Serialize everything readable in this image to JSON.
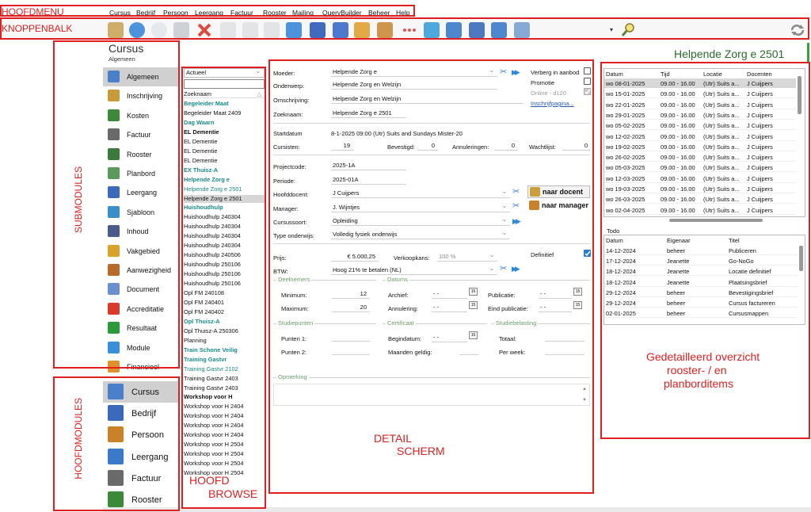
{
  "annotations": {
    "hoofdmenu": "HOOFDMENU",
    "knoppenbalk": "KNOPPENBALK",
    "submodules": "SUBMODULES",
    "hoofdmodules": "HOOFDMODULES",
    "hoofd_browse_1": "HOOFD",
    "hoofd_browse_2": "BROWSE",
    "detail_1": "DETAIL",
    "detail_2": "SCHERM",
    "overzicht_1": "Gedetailleerd overzicht",
    "overzicht_2": "rooster- / en",
    "overzicht_3": "planborditems"
  },
  "menu": [
    "Cursus",
    "Bedrijf",
    "Persoon",
    "Leergang",
    "Factuur",
    "Rooster",
    "Mailing",
    "QueryBuilder",
    "Beheer",
    "Help"
  ],
  "toolbar": {
    "icons": [
      "person-card-icon",
      "back-icon",
      "forward-icon",
      "edit-icon",
      "delete-icon",
      "save-icon",
      "undo-icon",
      "copy-icon",
      "mail-icon",
      "word-icon",
      "document-icon",
      "folder-icon",
      "users-icon",
      "dots-icon",
      "pen-icon",
      "print-icon",
      "chart-icon",
      "write-icon",
      "check-doc-icon"
    ],
    "search_icon": "search-icon",
    "refresh_icon": "refresh-icon"
  },
  "header": {
    "module_title": "Cursus",
    "module_sub": "Algemeen",
    "record_title": "Helpende Zorg e 2501"
  },
  "submodules": [
    "Algemeen",
    "Inschrijving",
    "Kosten",
    "Factuur",
    "Rooster",
    "Planbord",
    "Leergang",
    "Sjabloon",
    "Inhoud",
    "Vakgebied",
    "Aanwezigheid",
    "Document",
    "Accreditatie",
    "Resultaat",
    "Module",
    "Financieel"
  ],
  "submodule_colors": [
    "#4a7fc9",
    "#c79a3a",
    "#3a8a3a",
    "#6a6a6a",
    "#3a7a3a",
    "#5a9a5a",
    "#3a6ab9",
    "#3a8fc9",
    "#4a5a8a",
    "#d9a22a",
    "#b86a2a",
    "#6a8fcf",
    "#d93a2a",
    "#2a9a3a",
    "#3a8fd9",
    "#e0902a"
  ],
  "hoofdmodules": [
    "Cursus",
    "Bedrijf",
    "Persoon",
    "Leergang",
    "Factuur",
    "Rooster"
  ],
  "hoofdmodule_colors": [
    "#4a7fc9",
    "#3a6ab9",
    "#c9822a",
    "#3a7ac9",
    "#6a6a6a",
    "#3a8a3a"
  ],
  "browse": {
    "filter": "Actueel",
    "search_value": "",
    "column": "Zoeknaam",
    "rows": [
      {
        "t": "Begeleider Maat",
        "s": "bold"
      },
      {
        "t": "Begeleider Maat 2409",
        "s": ""
      },
      {
        "t": "Dag Waarn",
        "s": "bold"
      },
      {
        "t": "EL Dementie",
        "s": "black"
      },
      {
        "t": "EL Dementie",
        "s": ""
      },
      {
        "t": "EL Dementie",
        "s": ""
      },
      {
        "t": "EL Dementie",
        "s": ""
      },
      {
        "t": "EX Thuisz-A",
        "s": "bold"
      },
      {
        "t": "Helpende Zorg e",
        "s": "bold"
      },
      {
        "t": "Helpende Zorg e 2501",
        "s": "teal"
      },
      {
        "t": "Helpende Zorg e 2501",
        "s": "sel"
      },
      {
        "t": "Huishoudhulp",
        "s": "bold"
      },
      {
        "t": "Huishoudhulp 240304",
        "s": ""
      },
      {
        "t": "Huishoudhulp 240304",
        "s": ""
      },
      {
        "t": "Huishoudhulp 240304",
        "s": ""
      },
      {
        "t": "Huishoudhulp 240304",
        "s": ""
      },
      {
        "t": "Huishoudhulp 240506",
        "s": ""
      },
      {
        "t": "Huishoudhulp 250106",
        "s": ""
      },
      {
        "t": "Huishoudhulp 250106",
        "s": ""
      },
      {
        "t": "Huishoudhulp 250106",
        "s": ""
      },
      {
        "t": "Opl FM 240108",
        "s": ""
      },
      {
        "t": "Opl FM 240401",
        "s": ""
      },
      {
        "t": "Opl FM 240402",
        "s": ""
      },
      {
        "t": "Opl Thuisz-A",
        "s": "bold"
      },
      {
        "t": "Opl Thuisz-A 250306",
        "s": ""
      },
      {
        "t": "Planning",
        "s": ""
      },
      {
        "t": "Train Schone Veilig",
        "s": "bold"
      },
      {
        "t": "Training Gastvr",
        "s": "bold"
      },
      {
        "t": "Training Gastvr 2102",
        "s": "teal"
      },
      {
        "t": "Training Gastvr 2403",
        "s": ""
      },
      {
        "t": "Training Gastvr 2403",
        "s": ""
      },
      {
        "t": "Workshop voor H",
        "s": "black"
      },
      {
        "t": "Workshop voor H 2404",
        "s": ""
      },
      {
        "t": "Workshop voor H 2404",
        "s": ""
      },
      {
        "t": "Workshop voor H 2404",
        "s": ""
      },
      {
        "t": "Workshop voor H 2404",
        "s": ""
      },
      {
        "t": "Workshop voor H 2504",
        "s": ""
      },
      {
        "t": "Workshop voor H 2504",
        "s": ""
      },
      {
        "t": "Workshop voor H 2504",
        "s": ""
      },
      {
        "t": "Workshop voor H 2504",
        "s": ""
      }
    ]
  },
  "detail": {
    "moeder_label": "Moeder:",
    "moeder": "Helpende Zorg e",
    "onderwerp_label": "Onderwerp:",
    "onderwerp": "Helpende Zorg en Welzijn",
    "omschrijving_label": "Omschrijving:",
    "omschrijving": "Helpende Zorg en Welzijn",
    "zoeknaam_label": "Zoeknaam:",
    "zoeknaam": "Helpende Zorg e 2501",
    "verberg_label": "Verberg in aanbod",
    "promotie_label": "Promotie",
    "online_label": "Online - d120",
    "inschrijf_link": "Inschrijfpagina...",
    "startdatum_label": "Startdatum",
    "startdatum": "8-1-2025 09:00 (Utr) Suits and Sundays Mister-20",
    "cursisten_label": "Cursisten:",
    "cursisten": "19",
    "bevestigd_label": "Bevestigd:",
    "bevestigd": "0",
    "annuleringen_label": "Annuleringen:",
    "annuleringen": "0",
    "wachtlijst_label": "Wachtlijst:",
    "wachtlijst": "0",
    "projectcode_label": "Projectcode:",
    "projectcode": "2025-1A",
    "periode_label": "Periode:",
    "periode": "2025-01A",
    "hoofddocent_label": "Hoofddocent:",
    "hoofddocent": "J Cuijpers",
    "manager_label": "Manager:",
    "manager": "J. Wijntjes",
    "naar_docent": "naar docent",
    "naar_manager": "naar manager",
    "cursussoort_label": "Cursussoort:",
    "cursussoort": "Opleiding",
    "type_label": "Type onderwijs:",
    "type": "Volledig fysiek onderwijs",
    "prijs_label": "Prijs:",
    "prijs": "€ 5.000,25",
    "verkoopkans_label": "Verkoopkans:",
    "verkoopkans": "100 %",
    "definitief_label": "Definitief",
    "btw_label": "BTW:",
    "btw": "Hoog 21% te betalen (NL)",
    "deelnemers_grp": "Deelnemers",
    "minimum_label": "Minimum:",
    "minimum": "12",
    "maximum_label": "Maximum:",
    "maximum": "20",
    "datums_grp": "Datums",
    "archief_label": "Archief:",
    "archief": "- -",
    "annulering_label": "Annulering:",
    "annulering": "- -",
    "publicatie_label": "Publicatie:",
    "publicatie": "- -",
    "eind_publicatie_label": "Eind publicatie:",
    "eind_publicatie": "- -",
    "studiepunten_grp": "Studiepunten",
    "punten1_label": "Punten 1:",
    "punten1": "",
    "punten2_label": "Punten 2:",
    "punten2": "",
    "certificaat_grp": "Certificaat",
    "begindatum_label": "Begindatum:",
    "begindatum": "- -",
    "maanden_label": "Maanden geldig:",
    "maanden": "",
    "studiebelasting_grp": "Studiebelasting",
    "totaal_label": "Totaal:",
    "totaal": "",
    "perweek_label": "Per week:",
    "perweek": "",
    "opmerking_grp": "Opmerking",
    "opmerking": ""
  },
  "rooster": {
    "headers": [
      "Datum",
      "Tijd",
      "Locatie",
      "Docenten"
    ],
    "rows": [
      [
        "wo 08-01-2025",
        "09.00 - 16.00",
        "(Utr) Suits a...",
        "J Cuijpers"
      ],
      [
        "wo 15-01-2025",
        "09.00 - 16.00",
        "(Utr) Suits a...",
        "J Cuijpers"
      ],
      [
        "wo 22-01-2025",
        "09.00 - 16.00",
        "(Utr) Suits a...",
        "J Cuijpers"
      ],
      [
        "wo 29-01-2025",
        "09.00 - 16.00",
        "(Utr) Suits a...",
        "J Cuijpers"
      ],
      [
        "wo 05-02-2025",
        "09.00 - 16.00",
        "(Utr) Suits a...",
        "J Cuijpers"
      ],
      [
        "wo 12-02-2025",
        "09.00 - 16.00",
        "(Utr) Suits a...",
        "J Cuijpers"
      ],
      [
        "wo 19-02-2025",
        "09.00 - 16.00",
        "(Utr) Suits a...",
        "J Cuijpers"
      ],
      [
        "wo 26-02-2025",
        "09.00 - 16.00",
        "(Utr) Suits a...",
        "J Cuijpers"
      ],
      [
        "wo 05-03-2025",
        "09.00 - 16.00",
        "(Utr) Suits a...",
        "J Cuijpers"
      ],
      [
        "wo 12-03-2025",
        "09.00 - 16.00",
        "(Utr) Suits a...",
        "J Cuijpers"
      ],
      [
        "wo 19-03-2025",
        "09.00 - 16.00",
        "(Utr) Suits a...",
        "J Cuijpers"
      ],
      [
        "wo 26-03-2025",
        "09.00 - 16.00",
        "(Utr) Suits a...",
        "J Cuijpers"
      ],
      [
        "wo 02-04-2025",
        "09.00 - 16.00",
        "(Utr) Suits a...",
        "J Cuijpers"
      ]
    ]
  },
  "todo": {
    "title": "Todo",
    "headers": [
      "Datum",
      "Eigenaar",
      "Titel"
    ],
    "rows": [
      [
        "14-12-2024",
        "beheer",
        "Publiceren"
      ],
      [
        "17-12-2024",
        "Jeanette",
        "Go-NoGo"
      ],
      [
        "18-12-2024",
        "Jeanette",
        "Locatie definitief"
      ],
      [
        "18-12-2024",
        "Jeanette",
        "Plaatsingsbrief"
      ],
      [
        "29-12-2024",
        "beheer",
        "Bevestigingsbrief"
      ],
      [
        "29-12-2024",
        "beheer",
        "Cursus factureren"
      ],
      [
        "02-01-2025",
        "beheer",
        "Cursusmappen"
      ]
    ]
  }
}
